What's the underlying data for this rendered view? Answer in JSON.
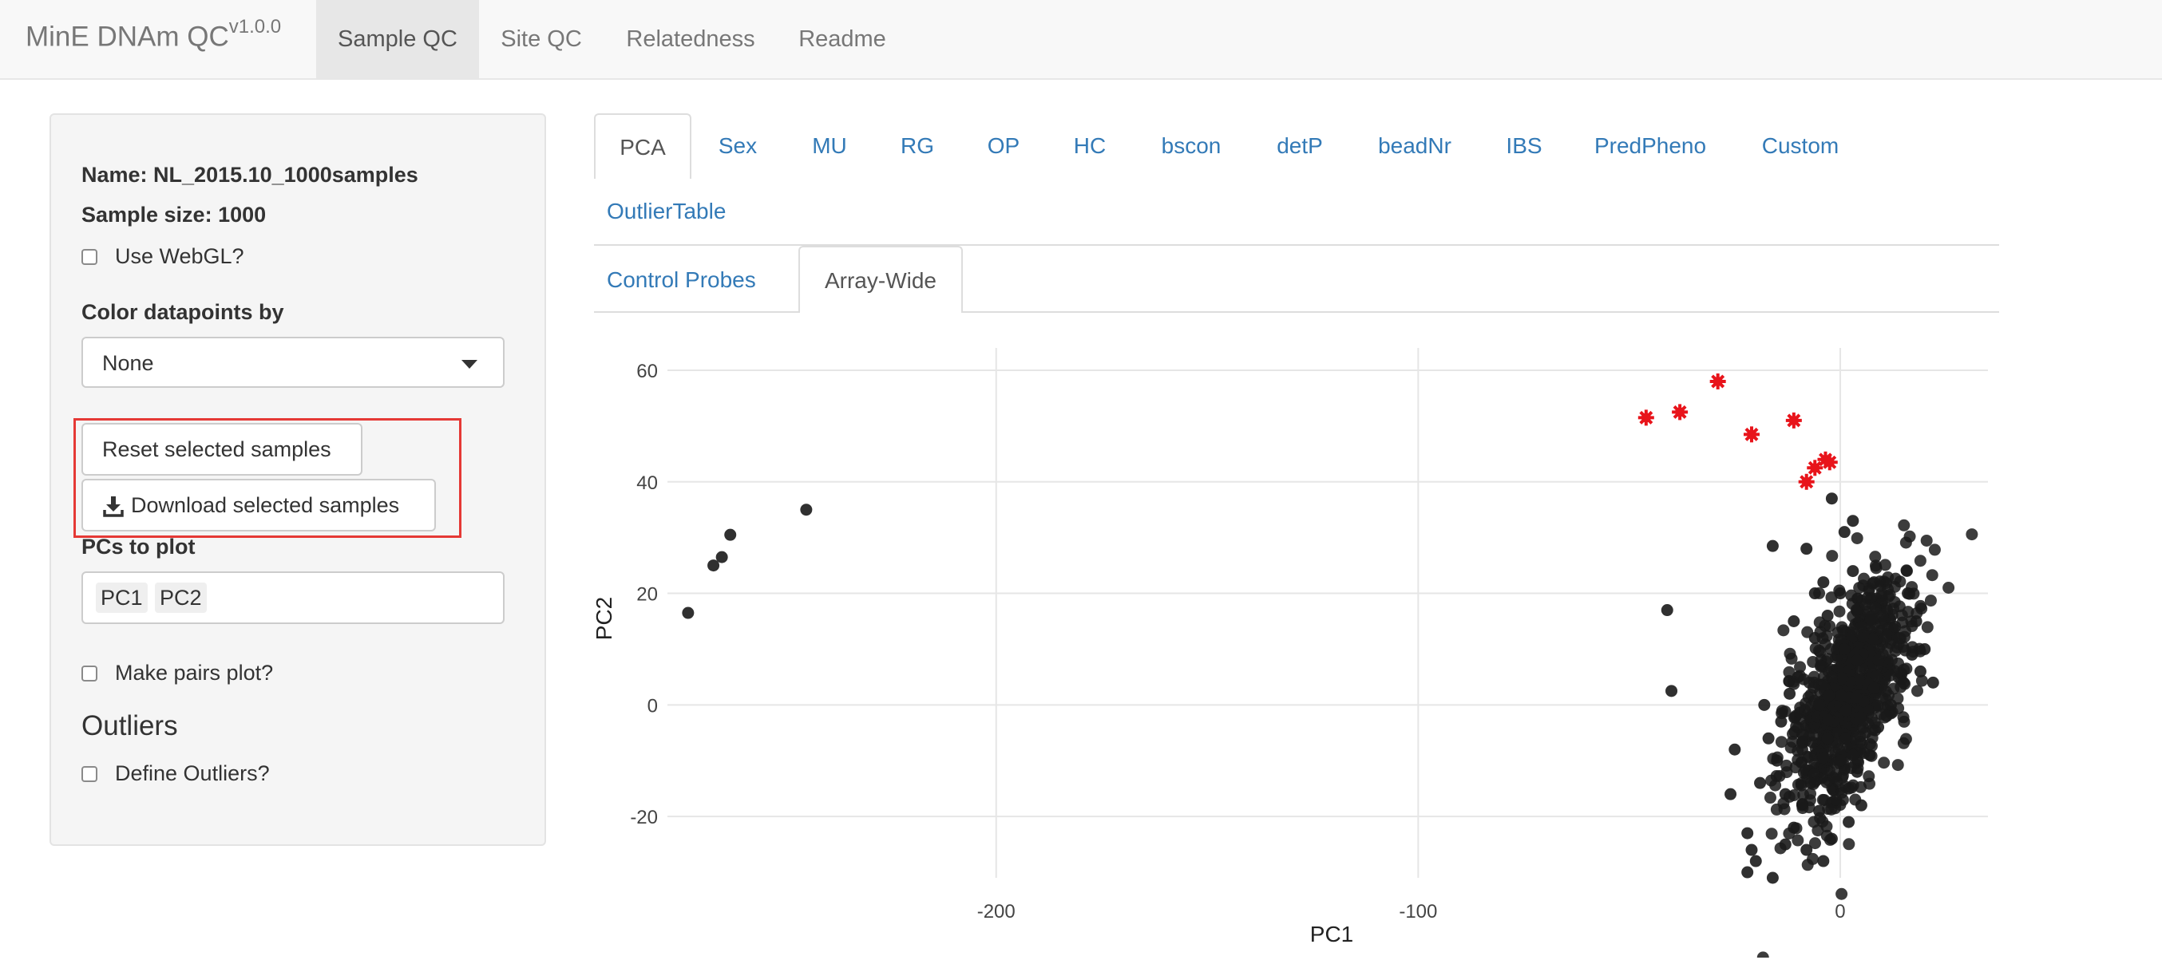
{
  "navbar": {
    "brand": "MinE DNAm QC",
    "version": "v1.0.0",
    "tabs": [
      {
        "label": "Sample QC",
        "active": true
      },
      {
        "label": "Site QC",
        "active": false
      },
      {
        "label": "Relatedness",
        "active": false
      },
      {
        "label": "Readme",
        "active": false
      }
    ]
  },
  "sidebar": {
    "name_label": "Name:",
    "name_value": "NL_2015.10_1000samples",
    "size_label": "Sample size:",
    "size_value": "1000",
    "webgl_label": "Use WebGL?",
    "webgl_checked": false,
    "color_by_label": "Color datapoints by",
    "color_by_value": "None",
    "reset_button": "Reset selected samples",
    "download_button": "Download selected samples",
    "pcs_label": "PCs to plot",
    "pcs_selected": [
      "PC1",
      "PC2"
    ],
    "pairs_label": "Make pairs plot?",
    "pairs_checked": false,
    "outliers_heading": "Outliers",
    "define_outliers_label": "Define Outliers?",
    "define_outliers_checked": false
  },
  "tabs": {
    "row1": [
      "PCA",
      "Sex",
      "MU",
      "RG",
      "OP",
      "HC",
      "bscon",
      "detP",
      "beadNr",
      "IBS",
      "PredPheno",
      "Custom"
    ],
    "row1_active": "PCA",
    "row2": [
      "OutlierTable"
    ],
    "sub": [
      "Control Probes",
      "Array-Wide"
    ],
    "sub_active": "Array-Wide"
  },
  "colors": {
    "link": "#337ab7",
    "point": "#1a1a1a",
    "selected_point": "#e8141b",
    "highlight_border": "#e53935"
  },
  "chart_data": {
    "type": "scatter",
    "xlabel": "PC1",
    "ylabel": "PC2",
    "xlim": [
      -276,
      35
    ],
    "ylim": [
      -31,
      62
    ],
    "x_ticks": [
      -200,
      -100,
      0
    ],
    "y_ticks": [
      -20,
      0,
      20,
      40,
      60
    ],
    "grid": true,
    "legend": "none",
    "series": [
      {
        "marker": "circle",
        "color": "#1a1a1a",
        "points": [
          [
            -273,
            16.5
          ],
          [
            -267,
            25
          ],
          [
            -265,
            26.5
          ],
          [
            -263,
            30.5
          ],
          [
            -245,
            35
          ],
          [
            -41,
            17
          ],
          [
            -40,
            2.5
          ],
          [
            -16,
            28.5
          ],
          [
            -8,
            28
          ],
          [
            -6,
            20
          ],
          [
            -2,
            37
          ],
          [
            1,
            31
          ],
          [
            3,
            33
          ],
          [
            -26,
            -16
          ],
          [
            -25,
            -8
          ],
          [
            -22,
            -23
          ],
          [
            -21,
            -26
          ],
          [
            -20,
            -28
          ],
          [
            -22,
            -30
          ],
          [
            -16,
            -31
          ],
          [
            -13,
            -25
          ],
          [
            -11,
            -22
          ],
          [
            -8,
            -26
          ],
          [
            -4,
            -28
          ],
          [
            -2,
            -24
          ],
          [
            2,
            -21
          ],
          [
            5,
            -18
          ],
          [
            -12,
            2
          ],
          [
            -14,
            -3
          ],
          [
            -18,
            0
          ],
          [
            -10,
            5
          ],
          [
            -9,
            -8
          ],
          [
            -6,
            12
          ],
          [
            -11,
            15
          ],
          [
            -4,
            22
          ],
          [
            3,
            24
          ],
          [
            6,
            18
          ],
          [
            10,
            16
          ],
          [
            14,
            12
          ],
          [
            17,
            9
          ],
          [
            19,
            6
          ],
          [
            15,
            4
          ],
          [
            12,
            0
          ],
          [
            9,
            -4
          ],
          [
            7,
            -9
          ],
          [
            4,
            -12
          ],
          [
            2,
            -15
          ],
          [
            0,
            -10
          ],
          [
            -3,
            -6
          ],
          [
            -5,
            0
          ],
          [
            -2,
            5
          ],
          [
            1,
            10
          ],
          [
            4,
            8
          ],
          [
            8,
            3
          ],
          [
            11,
            -2
          ],
          [
            13,
            14
          ],
          [
            16,
            20
          ],
          [
            18,
            15
          ],
          [
            20,
            10
          ],
          [
            22,
            4
          ],
          [
            -7,
            -14
          ],
          [
            -9,
            -18
          ],
          [
            -5,
            -19
          ],
          [
            -1,
            -17
          ],
          [
            3,
            -9
          ],
          [
            6,
            -5
          ],
          [
            9,
            8
          ],
          [
            -15,
            -10
          ],
          [
            -17,
            -6
          ],
          [
            -19,
            -14
          ],
          [
            -13,
            -16
          ],
          [
            0,
            20
          ],
          [
            -3,
            16
          ],
          [
            5,
            14
          ],
          [
            8,
            22
          ]
        ]
      },
      {
        "name": "selected",
        "marker": "star",
        "color": "#e8141b",
        "points": [
          [
            -46,
            51.5
          ],
          [
            -38,
            52.5
          ],
          [
            -29,
            58
          ],
          [
            -21,
            48.5
          ],
          [
            -11,
            51
          ],
          [
            -8,
            40
          ],
          [
            -6,
            42.5
          ],
          [
            -3.5,
            44
          ],
          [
            -2.5,
            43.5
          ]
        ]
      }
    ]
  }
}
